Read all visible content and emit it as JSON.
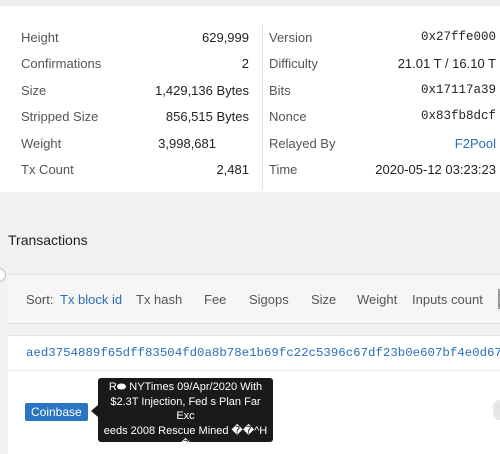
{
  "block": {
    "left": [
      {
        "label": "Height",
        "value": "629,999"
      },
      {
        "label": "Confirmations",
        "value": "2"
      },
      {
        "label": "Size",
        "value": "1,429,136 Bytes"
      },
      {
        "label": "Stripped Size",
        "value": "856,515 Bytes"
      },
      {
        "label": "Weight",
        "value": "3,998,681"
      },
      {
        "label": "Tx Count",
        "value": "2,481"
      }
    ],
    "right": [
      {
        "label": "Version",
        "value": "0x27ffe000"
      },
      {
        "label": "Difficulty",
        "value": "21.01 T / 16.10 T"
      },
      {
        "label": "Bits",
        "value": "0x17117a39"
      },
      {
        "label": "Nonce",
        "value": "0x83fb8dcf"
      },
      {
        "label": "Relayed By",
        "value": "F2Pool"
      },
      {
        "label": "Time",
        "value": "2020-05-12 03:23:23"
      }
    ]
  },
  "transactions": {
    "title": "Transactions",
    "sort_label": "Sort:",
    "sort_options": [
      "Tx block id",
      "Tx hash",
      "Fee",
      "Sigops",
      "Size",
      "Weight",
      "Inputs count"
    ],
    "tx_hash": "aed3754889f65dff83504fd0a8b78e1b69fc22c5396c67df23b0e607bf4e0d67",
    "coinbase_badge": "Coinbase",
    "tooltip_lines": [
      "R⬬ NYTimes 09/Apr/2020 With",
      "$2.3T Injection, Fed s Plan Far Exc",
      "eeds 2008 Rescue  Mined  ��^H",
      "�"
    ]
  }
}
